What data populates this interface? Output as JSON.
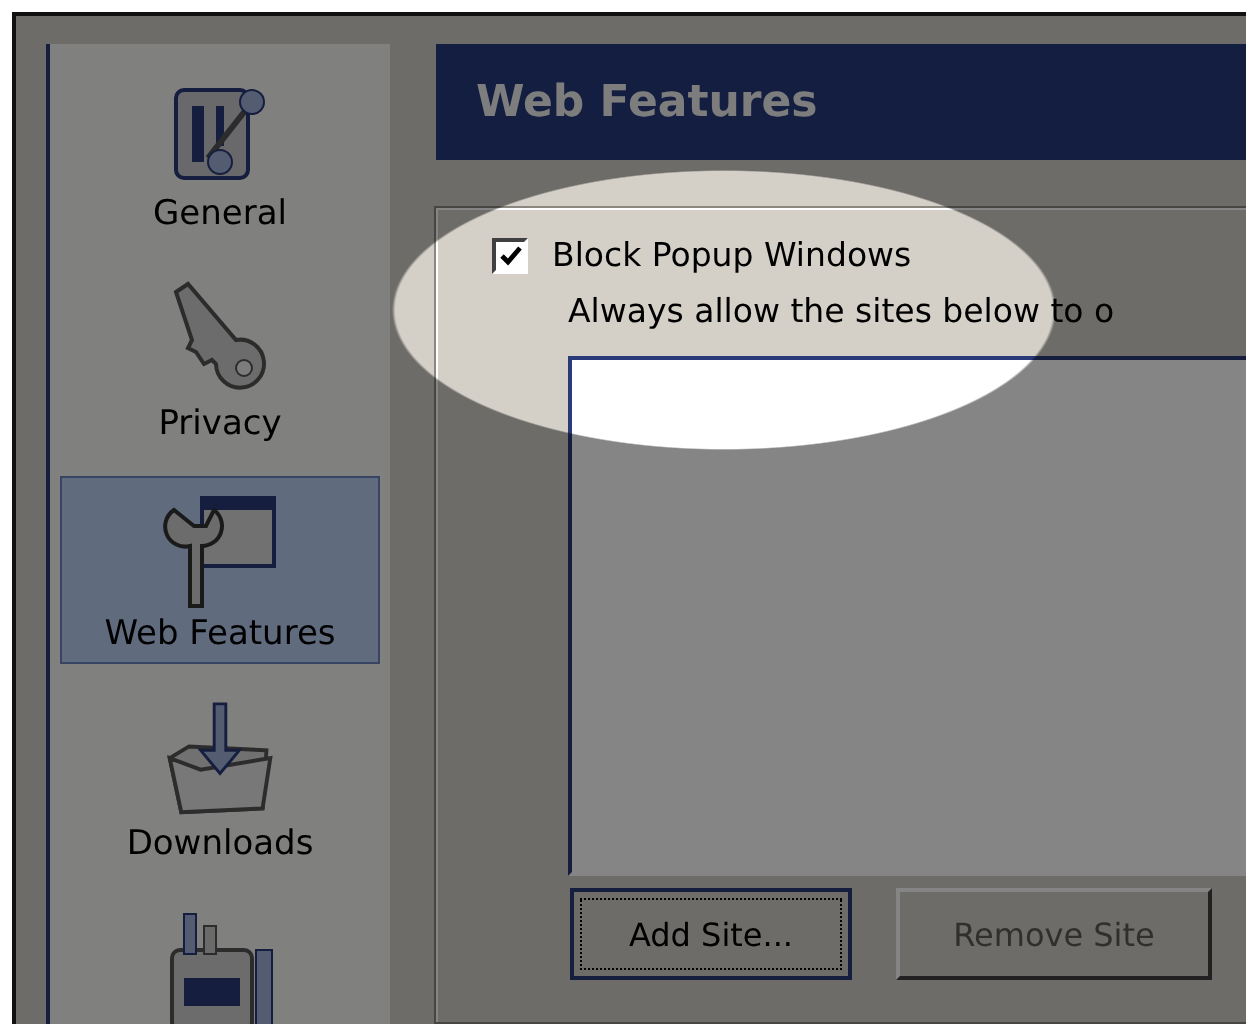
{
  "sidebar": {
    "items": [
      {
        "label": "General",
        "selected": false
      },
      {
        "label": "Privacy",
        "selected": false
      },
      {
        "label": "Web Features",
        "selected": true
      },
      {
        "label": "Downloads",
        "selected": false
      },
      {
        "selected": false
      }
    ]
  },
  "header": {
    "title": "Web Features"
  },
  "popups": {
    "checkbox": {
      "label": "Block Popup Windows",
      "checked": true
    },
    "hint": "Always allow the sites below to o",
    "buttons": [
      {
        "label": "Add Site...",
        "disabled": false,
        "focused": true
      },
      {
        "label": "Remove Site",
        "disabled": true
      }
    ]
  }
}
